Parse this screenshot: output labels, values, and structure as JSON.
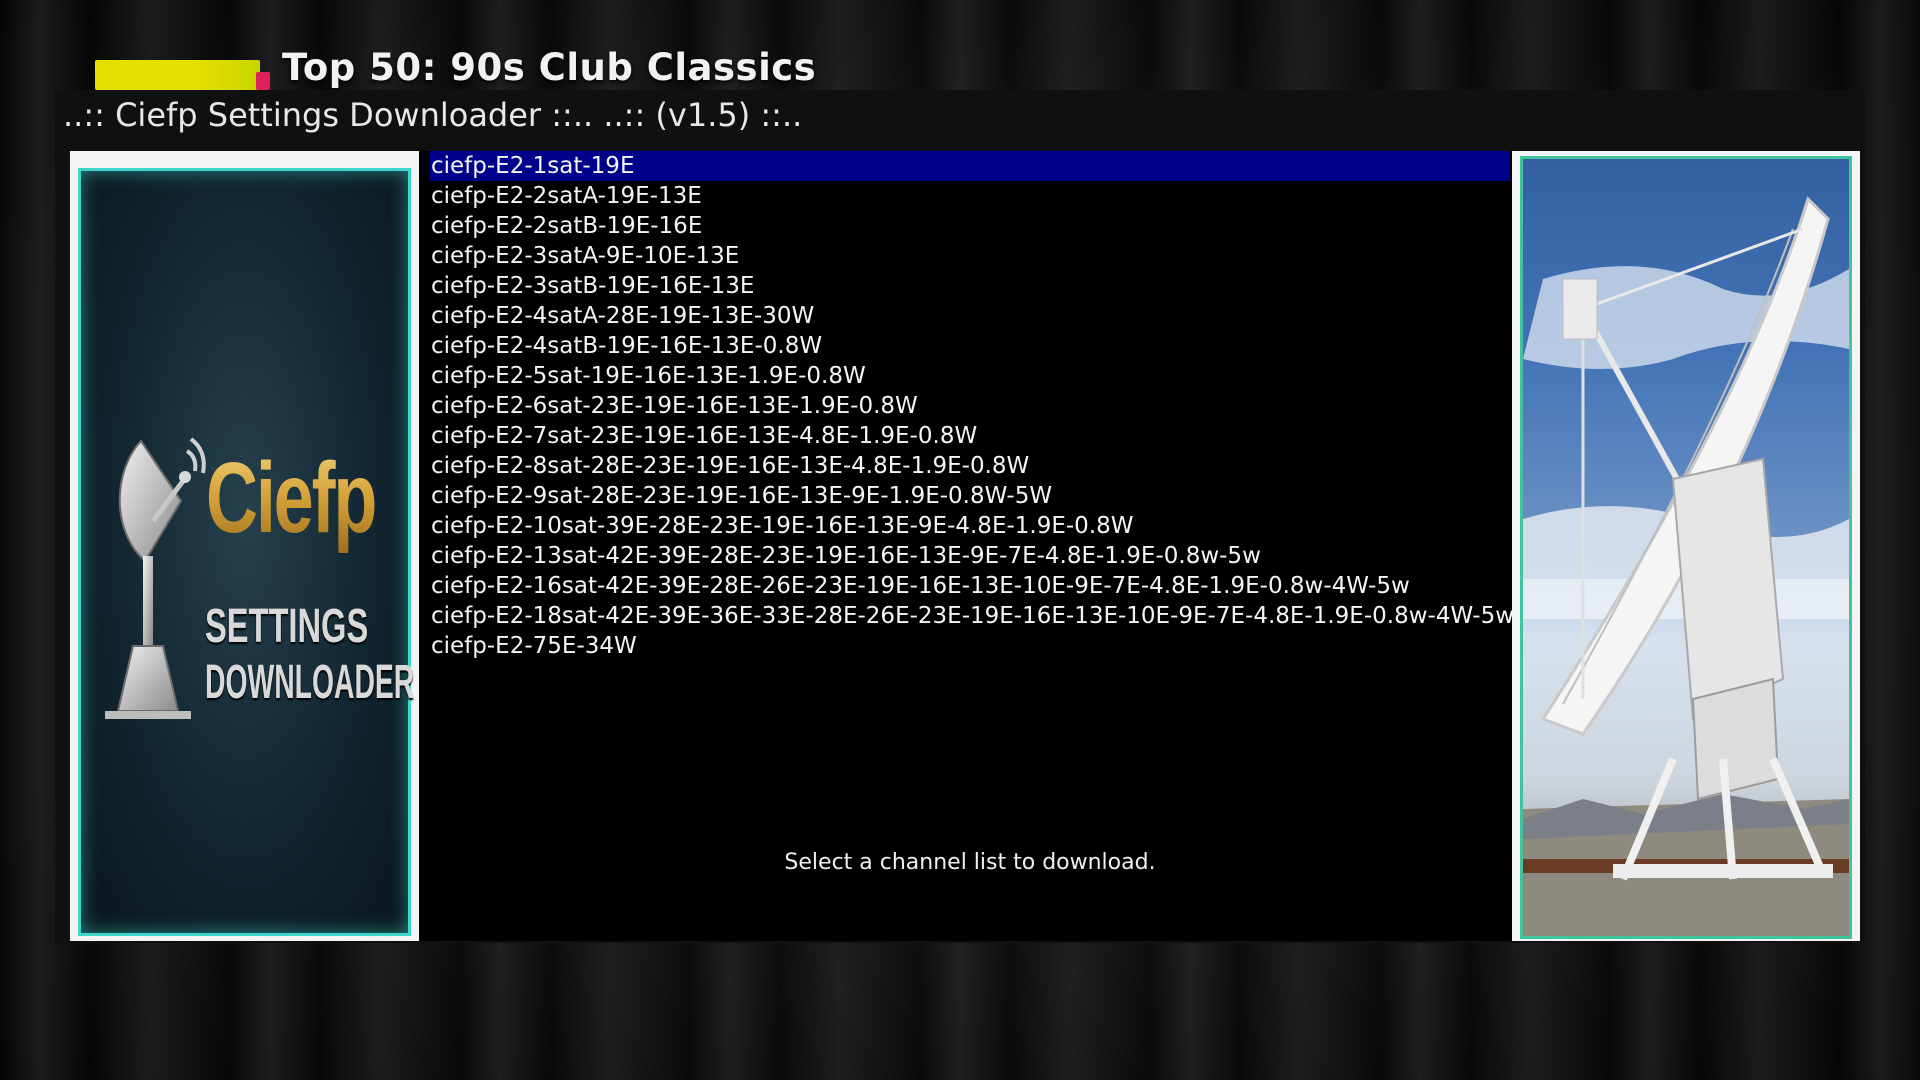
{
  "background_show": {
    "title": "Top 50: 90s Club Classics"
  },
  "window": {
    "title": "..:: Ciefp Settings Downloader ::.. ..:: (v1.5) ::.."
  },
  "logo": {
    "brand": "Ciefp",
    "line1": "SETTINGS",
    "line2": "DOWNLOADER",
    "icon": "satellite-dish-icon"
  },
  "channel_lists": {
    "selected_index": 0,
    "items": [
      "ciefp-E2-1sat-19E",
      "ciefp-E2-2satA-19E-13E",
      "ciefp-E2-2satB-19E-16E",
      "ciefp-E2-3satA-9E-10E-13E",
      "ciefp-E2-3satB-19E-16E-13E",
      "ciefp-E2-4satA-28E-19E-13E-30W",
      "ciefp-E2-4satB-19E-16E-13E-0.8W",
      "ciefp-E2-5sat-19E-16E-13E-1.9E-0.8W",
      "ciefp-E2-6sat-23E-19E-16E-13E-1.9E-0.8W",
      "ciefp-E2-7sat-23E-19E-16E-13E-4.8E-1.9E-0.8W",
      "ciefp-E2-8sat-28E-23E-19E-16E-13E-4.8E-1.9E-0.8W",
      "ciefp-E2-9sat-28E-23E-19E-16E-13E-9E-1.9E-0.8W-5W",
      "ciefp-E2-10sat-39E-28E-23E-19E-16E-13E-9E-4.8E-1.9E-0.8W",
      "ciefp-E2-13sat-42E-39E-28E-23E-19E-16E-13E-9E-7E-4.8E-1.9E-0.8w-5w",
      "ciefp-E2-16sat-42E-39E-28E-26E-23E-19E-16E-13E-10E-9E-7E-4.8E-1.9E-0.8w-4W-5w",
      "ciefp-E2-18sat-42E-39E-36E-33E-28E-26E-23E-19E-16E-13E-10E-9E-7E-4.8E-1.9E-0.8w-4W-5w",
      "ciefp-E2-75E-34W"
    ]
  },
  "status": {
    "message": "Select a channel list to download."
  },
  "colors": {
    "selection": "#00008b",
    "panel_border_teal": "#3ed6c8",
    "logo_gold": "#d9a93a"
  },
  "images": {
    "right_panel": "radio-telescope-dish-icon"
  }
}
